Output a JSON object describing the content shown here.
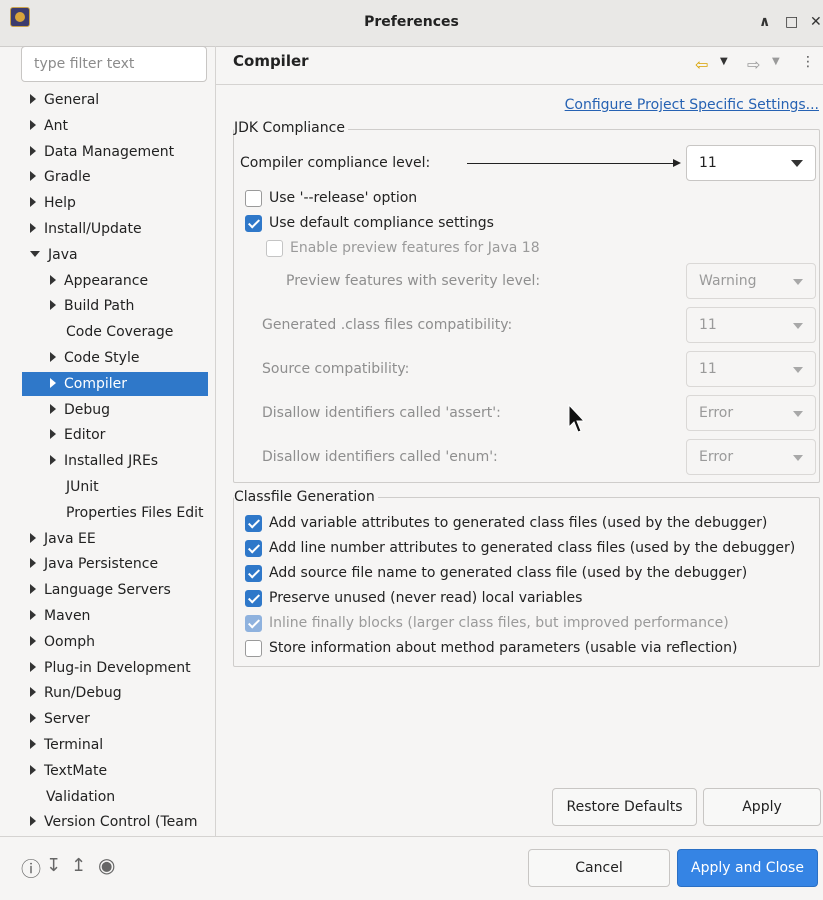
{
  "window": {
    "title": "Preferences",
    "controls": {
      "minimize": "∧",
      "maximize": "□",
      "close": "✕"
    }
  },
  "filter": {
    "placeholder": "type filter text",
    "value": ""
  },
  "tree": [
    {
      "label": "General",
      "level": 0,
      "state": "collapsed"
    },
    {
      "label": "Ant",
      "level": 0,
      "state": "collapsed"
    },
    {
      "label": "Data Management",
      "level": 0,
      "state": "collapsed"
    },
    {
      "label": "Gradle",
      "level": 0,
      "state": "collapsed"
    },
    {
      "label": "Help",
      "level": 0,
      "state": "collapsed"
    },
    {
      "label": "Install/Update",
      "level": 0,
      "state": "collapsed"
    },
    {
      "label": "Java",
      "level": 0,
      "state": "expanded"
    },
    {
      "label": "Appearance",
      "level": 1,
      "state": "collapsed"
    },
    {
      "label": "Build Path",
      "level": 1,
      "state": "collapsed"
    },
    {
      "label": "Code Coverage",
      "level": 1,
      "state": "leaf"
    },
    {
      "label": "Code Style",
      "level": 1,
      "state": "collapsed"
    },
    {
      "label": "Compiler",
      "level": 1,
      "state": "collapsed",
      "selected": true
    },
    {
      "label": "Debug",
      "level": 1,
      "state": "collapsed"
    },
    {
      "label": "Editor",
      "level": 1,
      "state": "collapsed"
    },
    {
      "label": "Installed JREs",
      "level": 1,
      "state": "collapsed"
    },
    {
      "label": "JUnit",
      "level": 1,
      "state": "leaf"
    },
    {
      "label": "Properties Files Edit",
      "level": 1,
      "state": "leaf"
    },
    {
      "label": "Java EE",
      "level": 0,
      "state": "collapsed"
    },
    {
      "label": "Java Persistence",
      "level": 0,
      "state": "collapsed"
    },
    {
      "label": "Language Servers",
      "level": 0,
      "state": "collapsed"
    },
    {
      "label": "Maven",
      "level": 0,
      "state": "collapsed"
    },
    {
      "label": "Oomph",
      "level": 0,
      "state": "collapsed"
    },
    {
      "label": "Plug-in Development",
      "level": 0,
      "state": "collapsed"
    },
    {
      "label": "Run/Debug",
      "level": 0,
      "state": "collapsed"
    },
    {
      "label": "Server",
      "level": 0,
      "state": "collapsed"
    },
    {
      "label": "Terminal",
      "level": 0,
      "state": "collapsed"
    },
    {
      "label": "TextMate",
      "level": 0,
      "state": "collapsed"
    },
    {
      "label": "Validation",
      "level": 0,
      "state": "leaf"
    },
    {
      "label": "Version Control (Team",
      "level": 0,
      "state": "collapsed"
    }
  ],
  "page": {
    "title": "Compiler",
    "configure_link": "Configure Project Specific Settings...",
    "jdk_group": {
      "title": "JDK Compliance",
      "compliance_label": "Compiler compliance level:",
      "compliance_value": "11",
      "release_option": {
        "label": "Use '--release' option",
        "checked": false
      },
      "default_compliance": {
        "label": "Use default compliance settings",
        "checked": true
      },
      "preview_features": {
        "label": "Enable preview features for Java 18",
        "checked": false,
        "enabled": false
      },
      "preview_severity": {
        "label": "Preview features with severity level:",
        "value": "Warning"
      },
      "class_compat": {
        "label": "Generated .class files compatibility:",
        "value": "11"
      },
      "source_compat": {
        "label": "Source compatibility:",
        "value": "11"
      },
      "assert_ids": {
        "label": "Disallow identifiers called 'assert':",
        "value": "Error"
      },
      "enum_ids": {
        "label": "Disallow identifiers called 'enum':",
        "value": "Error"
      }
    },
    "classfile_group": {
      "title": "Classfile Generation",
      "options": [
        {
          "label": "Add variable attributes to generated class files (used by the debugger)",
          "checked": true,
          "enabled": true
        },
        {
          "label": "Add line number attributes to generated class files (used by the debugger)",
          "checked": true,
          "enabled": true
        },
        {
          "label": "Add source file name to generated class file (used by the debugger)",
          "checked": true,
          "enabled": true
        },
        {
          "label": "Preserve unused (never read) local variables",
          "checked": true,
          "enabled": true
        },
        {
          "label": "Inline finally blocks (larger class files, but improved performance)",
          "checked": true,
          "enabled": false
        },
        {
          "label": "Store information about method parameters (usable via reflection)",
          "checked": false,
          "enabled": true
        }
      ]
    },
    "restore_defaults": "Restore Defaults",
    "apply": "Apply"
  },
  "footer": {
    "cancel": "Cancel",
    "apply_and_close": "Apply and Close",
    "icons": [
      "help-icon",
      "import-icon",
      "export-icon",
      "record-icon"
    ]
  }
}
